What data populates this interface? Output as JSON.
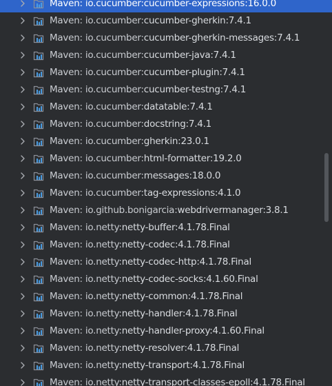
{
  "prefix": "Maven: ",
  "items": [
    {
      "group": "io.cucumber:",
      "artifact": "cucumber-expressions:16.0.0",
      "selected": true
    },
    {
      "group": "io.cucumber:",
      "artifact": "cucumber-gherkin:7.4.1"
    },
    {
      "group": "io.cucumber:",
      "artifact": "cucumber-gherkin-messages:7.4.1"
    },
    {
      "group": "io.cucumber:",
      "artifact": "cucumber-java:7.4.1"
    },
    {
      "group": "io.cucumber:",
      "artifact": "cucumber-plugin:7.4.1"
    },
    {
      "group": "io.cucumber:",
      "artifact": "cucumber-testng:7.4.1"
    },
    {
      "group": "io.cucumber:",
      "artifact": "datatable:7.4.1"
    },
    {
      "group": "io.cucumber:",
      "artifact": "docstring:7.4.1"
    },
    {
      "group": "io.cucumber:",
      "artifact": "gherkin:23.0.1"
    },
    {
      "group": "io.cucumber:",
      "artifact": "html-formatter:19.2.0"
    },
    {
      "group": "io.cucumber:",
      "artifact": "messages:18.0.0"
    },
    {
      "group": "io.cucumber:",
      "artifact": "tag-expressions:4.1.0"
    },
    {
      "group": "io.github.bonigarcia:",
      "artifact": "webdrivermanager:3.8.1"
    },
    {
      "group": "io.netty:",
      "artifact": "netty-buffer:4.1.78.Final"
    },
    {
      "group": "io.netty:",
      "artifact": "netty-codec:4.1.78.Final"
    },
    {
      "group": "io.netty:",
      "artifact": "netty-codec-http:4.1.78.Final"
    },
    {
      "group": "io.netty:",
      "artifact": "netty-codec-socks:4.1.60.Final"
    },
    {
      "group": "io.netty:",
      "artifact": "netty-common:4.1.78.Final"
    },
    {
      "group": "io.netty:",
      "artifact": "netty-handler:4.1.78.Final"
    },
    {
      "group": "io.netty:",
      "artifact": "netty-handler-proxy:4.1.60.Final"
    },
    {
      "group": "io.netty:",
      "artifact": "netty-resolver:4.1.78.Final"
    },
    {
      "group": "io.netty:",
      "artifact": "netty-transport:4.1.78.Final"
    },
    {
      "group": "io.netty:",
      "artifact": "netty-transport-classes-epoll:4.1.78.Final"
    }
  ],
  "icons": {
    "expand": "chevron-right-icon",
    "library": "library-icon"
  },
  "colors": {
    "background": "#2b2d30",
    "selection": "#2f65ca",
    "text": "#c9ccd1",
    "chevron": "#a8abb0",
    "icon_folder": "#8c9099",
    "icon_bars": "#4a9ee5",
    "scrollbar_thumb": "#53565b"
  }
}
